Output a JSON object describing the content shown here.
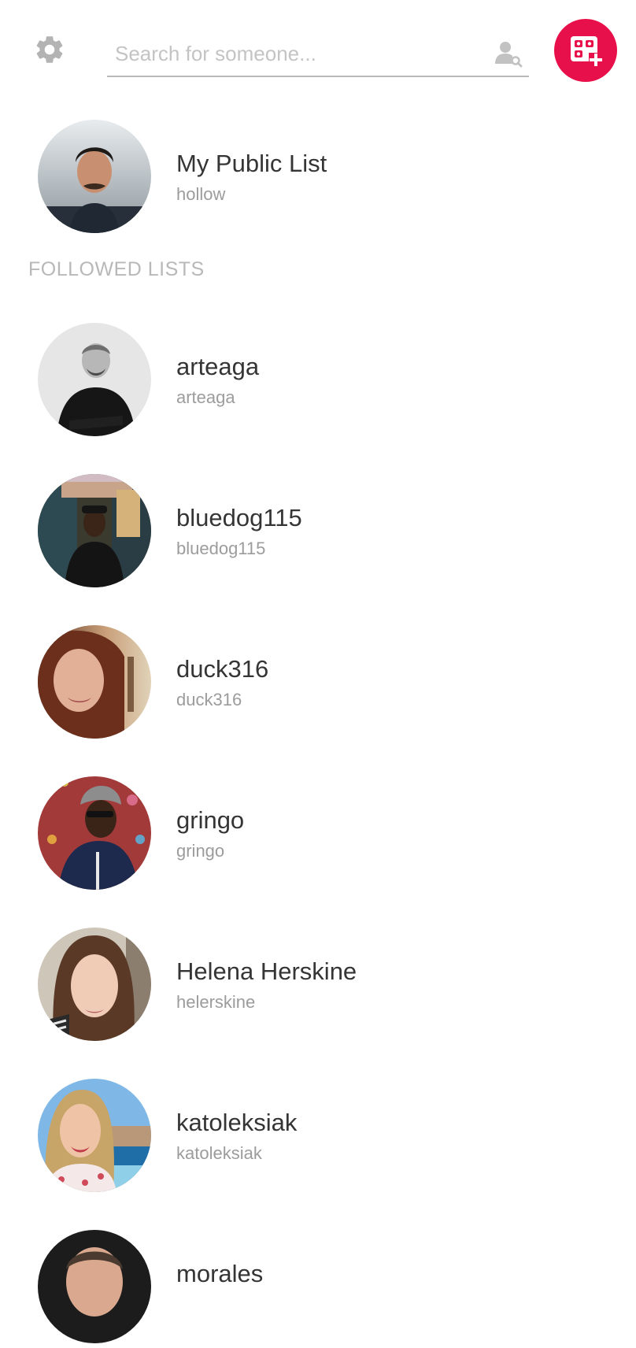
{
  "search": {
    "placeholder": "Search for someone..."
  },
  "icons": {
    "settings": "gear-icon",
    "people_search": "person-search-icon",
    "add_list": "add-list-icon"
  },
  "colors": {
    "accent": "#e8104a",
    "name_text": "#353535",
    "handle_text": "#9c9c9c",
    "section_label": "#b8b8b8"
  },
  "my_list": {
    "title": "My Public List",
    "handle": "hollow"
  },
  "section_title": "FOLLOWED LISTS",
  "followed": [
    {
      "name": "arteaga",
      "handle": "arteaga"
    },
    {
      "name": "bluedog115",
      "handle": "bluedog115"
    },
    {
      "name": "duck316",
      "handle": "duck316"
    },
    {
      "name": "gringo",
      "handle": "gringo"
    },
    {
      "name": "Helena Herskine",
      "handle": "helerskine"
    },
    {
      "name": "katoleksiak",
      "handle": "katoleksiak"
    },
    {
      "name": "morales",
      "handle": ""
    }
  ]
}
